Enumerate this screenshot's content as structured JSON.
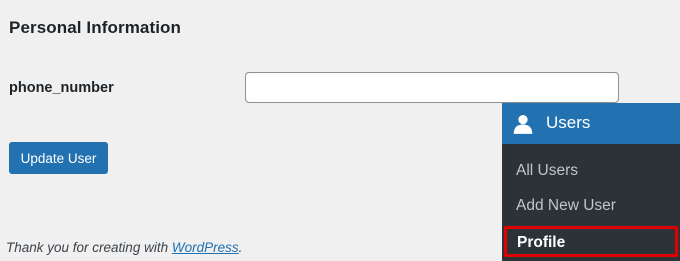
{
  "section": {
    "heading": "Personal Information"
  },
  "fields": {
    "phone_label": "phone_number",
    "phone_value": ""
  },
  "actions": {
    "update_label": "Update User"
  },
  "footer": {
    "text": "Thank you for creating with ",
    "link": "WordPress",
    "suffix": "."
  },
  "menu": {
    "title": "Users",
    "icon": "user-icon",
    "items": [
      {
        "label": "All Users"
      },
      {
        "label": "Add New User"
      },
      {
        "label": "Profile",
        "active": true,
        "highlight_color": "#e00000"
      }
    ]
  },
  "colors": {
    "accent": "#2271b1",
    "menu_bg": "#2c3338",
    "page_bg": "#f0f0f1"
  }
}
